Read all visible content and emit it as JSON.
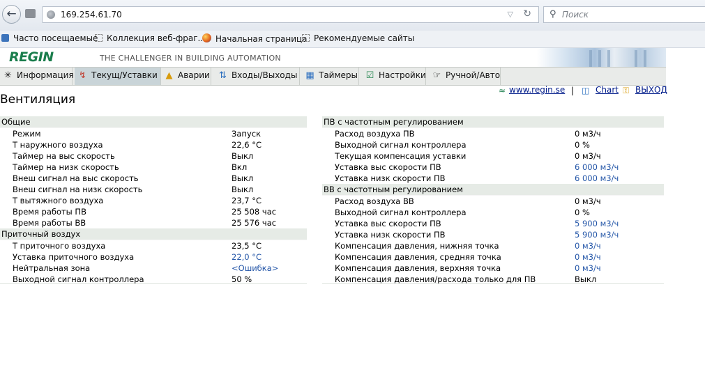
{
  "browser": {
    "url": "169.254.61.70",
    "search_placeholder": "Поиск",
    "back_icon": "arrow-left-icon"
  },
  "bookmarks": [
    {
      "label": "Часто посещаемые",
      "icon": "bookmark-icon"
    },
    {
      "label": "Коллекция веб-фраг...",
      "icon": "page-icon"
    },
    {
      "label": "Начальная страница",
      "icon": "firefox-icon"
    },
    {
      "label": "Рекомендуемые сайты",
      "icon": "page-icon"
    }
  ],
  "header": {
    "logo": "REGIN",
    "tagline": "THE CHALLENGER IN BUILDING AUTOMATION",
    "brand_color": "#1a7d4c"
  },
  "nav": [
    {
      "label": "Информация",
      "icon": "info-icon"
    },
    {
      "label": "Текущ/Уставки",
      "icon": "chart-icon"
    },
    {
      "label": "Аварии",
      "icon": "bell-icon"
    },
    {
      "label": "Входы/Выходы",
      "icon": "arrows-icon"
    },
    {
      "label": "Таймеры",
      "icon": "calendar-icon"
    },
    {
      "label": "Настройки",
      "icon": "checklist-icon"
    },
    {
      "label": "Ручной/Авто",
      "icon": "hand-icon"
    }
  ],
  "top_links": {
    "site": "www.regin.se",
    "separator": "|",
    "chart": "Chart",
    "exit": "ВЫХОД"
  },
  "page_title": "Вентиляция",
  "left_sections": [
    {
      "title": "Общие",
      "rows": [
        {
          "label": "Режим",
          "value": "Запуск"
        },
        {
          "label": "Т наружного воздуха",
          "value": "22,6 °C"
        },
        {
          "label": "Таймер на выс скорость",
          "value": "Выкл"
        },
        {
          "label": "Таймер на низк скорость",
          "value": "Вкл"
        },
        {
          "label": "Внеш сигнал на выс скорость",
          "value": "Выкл"
        },
        {
          "label": "Внеш сигнал на низк скорость",
          "value": "Выкл"
        },
        {
          "label": "Т вытяжного воздуха",
          "value": "23,7 °C"
        },
        {
          "label": "Время работы ПВ",
          "value": "25 508 час"
        },
        {
          "label": "Время работы ВВ",
          "value": "25 576 час"
        }
      ]
    },
    {
      "title": "Приточный воздух",
      "rows": [
        {
          "label": "Т приточного воздуха",
          "value": "23,5 °C"
        },
        {
          "label": "Уставка приточного воздуха",
          "value": "22,0 °C"
        },
        {
          "label": "Нейтральная зона",
          "value": "<Ошибка>"
        },
        {
          "label": "Выходной сигнал контроллера",
          "value": "50 %"
        }
      ]
    }
  ],
  "right_sections": [
    {
      "title": "ПВ с частотным регулированием",
      "rows": [
        {
          "label": "Расход воздуха ПВ",
          "value": "0 м3/ч"
        },
        {
          "label": "Выходной сигнал контроллера",
          "value": "0 %"
        },
        {
          "label": "Текущая компенсация уставки",
          "value": "0 м3/ч"
        },
        {
          "label": "Уставка выс скорости ПВ",
          "value": "6 000 м3/ч"
        },
        {
          "label": "Уставка низк скорости ПВ",
          "value": "6 000 м3/ч"
        }
      ]
    },
    {
      "title": "ВВ с частотным регулированием",
      "rows": [
        {
          "label": "Расход воздуха ВВ",
          "value": "0 м3/ч"
        },
        {
          "label": "Выходной сигнал контроллера",
          "value": "0 %"
        },
        {
          "label": "Уставка выс скорости ПВ",
          "value": "5 900 м3/ч"
        },
        {
          "label": "Уставка низк скорости ПВ",
          "value": "5 900 м3/ч"
        },
        {
          "label": "Компенсация давления, нижняя точка",
          "value": "0 м3/ч"
        },
        {
          "label": "Компенсация давления, средняя точка",
          "value": "0 м3/ч"
        },
        {
          "label": "Компенсация давления, верхняя точка",
          "value": "0 м3/ч"
        },
        {
          "label": "Компенсация давления/расхода только для ПВ",
          "value": "Выкл"
        }
      ]
    }
  ]
}
